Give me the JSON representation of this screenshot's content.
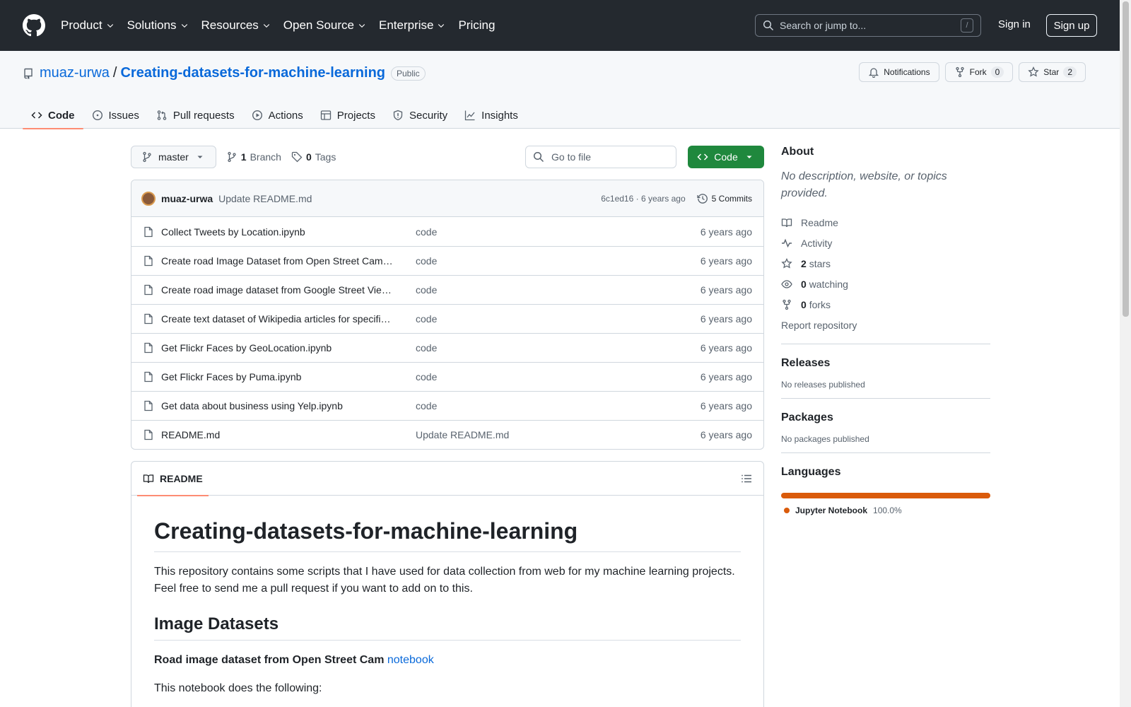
{
  "header": {
    "nav": [
      "Product",
      "Solutions",
      "Resources",
      "Open Source",
      "Enterprise",
      "Pricing"
    ],
    "search_placeholder": "Search or jump to...",
    "search_shortcut": "/",
    "signin": "Sign in",
    "signup": "Sign up"
  },
  "repo": {
    "owner": "muaz-urwa",
    "separator": "/",
    "name": "Creating-datasets-for-machine-learning",
    "visibility": "Public",
    "notifications_label": "Notifications",
    "fork_label": "Fork",
    "fork_count": "0",
    "star_label": "Star",
    "star_count": "2",
    "tabs": [
      "Code",
      "Issues",
      "Pull requests",
      "Actions",
      "Projects",
      "Security",
      "Insights"
    ]
  },
  "toolbar": {
    "branch": "master",
    "branch_count": "1",
    "branch_label": "Branch",
    "tag_count": "0",
    "tag_label": "Tags",
    "goto_placeholder": "Go to file",
    "code_label": "Code"
  },
  "commit": {
    "author": "muaz-urwa",
    "message": "Update README.md",
    "meta": "6c1ed16 · 6 years ago",
    "commits": "5 Commits"
  },
  "files": [
    {
      "name": "Collect Tweets by Location.ipynb",
      "commit": "code",
      "age": "6 years ago"
    },
    {
      "name": "Create road Image Dataset from Open Street Cam.ipynb",
      "commit": "code",
      "age": "6 years ago"
    },
    {
      "name": "Create road image dataset from Google Street View.ipynb",
      "commit": "code",
      "age": "6 years ago"
    },
    {
      "name": "Create text dataset of Wikipedia articles for specific topics.ipynb",
      "commit": "code",
      "age": "6 years ago"
    },
    {
      "name": "Get Flickr Faces by GeoLocation.ipynb",
      "commit": "code",
      "age": "6 years ago"
    },
    {
      "name": "Get Flickr Faces by Puma.ipynb",
      "commit": "code",
      "age": "6 years ago"
    },
    {
      "name": "Get data about business using Yelp.ipynb",
      "commit": "code",
      "age": "6 years ago"
    },
    {
      "name": "README.md",
      "commit": "Update README.md",
      "age": "6 years ago"
    }
  ],
  "readme": {
    "tab": "README",
    "title": "Creating-datasets-for-machine-learning",
    "intro": "This repository contains some scripts that I have used for data collection from web for my machine learning projects. Feel free to send me a pull request if you want to add on to this.",
    "h2": "Image Datasets",
    "item_title": "Road image dataset from Open Street Cam",
    "item_link": "notebook",
    "item_desc": "This notebook does the following:"
  },
  "sidebar": {
    "about_title": "About",
    "about_desc": "No description, website, or topics provided.",
    "readme": "Readme",
    "activity": "Activity",
    "stars_count": "2",
    "stars_label": "stars",
    "watching_count": "0",
    "watching_label": "watching",
    "forks_count": "0",
    "forks_label": "forks",
    "report": "Report repository",
    "releases_title": "Releases",
    "releases_desc": "No releases published",
    "packages_title": "Packages",
    "packages_desc": "No packages published",
    "languages_title": "Languages",
    "language_name": "Jupyter Notebook",
    "language_pct": "100.0%",
    "language_color": "#da5b0b"
  }
}
